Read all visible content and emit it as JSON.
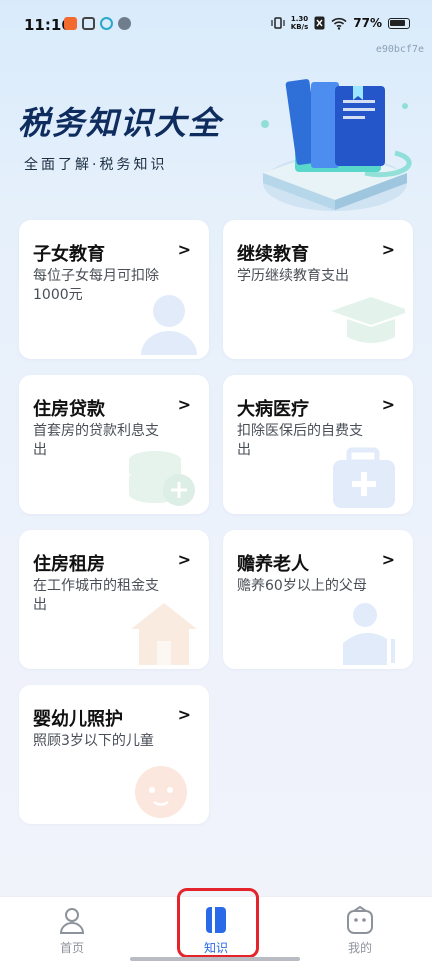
{
  "status_bar": {
    "time": "11:16",
    "network_speed_value": "1.30",
    "network_speed_unit": "KB/s",
    "battery": "77%"
  },
  "device_id": "e90bcf7e",
  "hero": {
    "title": "税务知识大全",
    "subtitle": "全面了解·税务知识"
  },
  "cards": [
    {
      "title": "子女教育",
      "desc": "每位子女每月可扣除1000元",
      "icon": "child-icon"
    },
    {
      "title": "继续教育",
      "desc": "学历继续教育支出",
      "icon": "graduation-cap-icon"
    },
    {
      "title": "住房贷款",
      "desc": "首套房的贷款利息支出",
      "icon": "coins-icon"
    },
    {
      "title": "大病医疗",
      "desc": "扣除医保后的自费支出",
      "icon": "medical-kit-icon"
    },
    {
      "title": "住房租房",
      "desc": "在工作城市的租金支出",
      "icon": "house-icon"
    },
    {
      "title": "赡养老人",
      "desc": "赡养60岁以上的父母",
      "icon": "elderly-icon"
    },
    {
      "title": "婴幼儿照护",
      "desc": "照顾3岁以下的儿童",
      "icon": "baby-icon"
    }
  ],
  "chevron": ">",
  "nav": {
    "items": [
      {
        "label": "首页",
        "icon": "person-icon"
      },
      {
        "label": "知识",
        "icon": "book-icon"
      },
      {
        "label": "我的",
        "icon": "profile-face-icon"
      }
    ],
    "active_index": 1,
    "active_color": "#2a6ae8",
    "highlight_color": "#e4232b"
  }
}
